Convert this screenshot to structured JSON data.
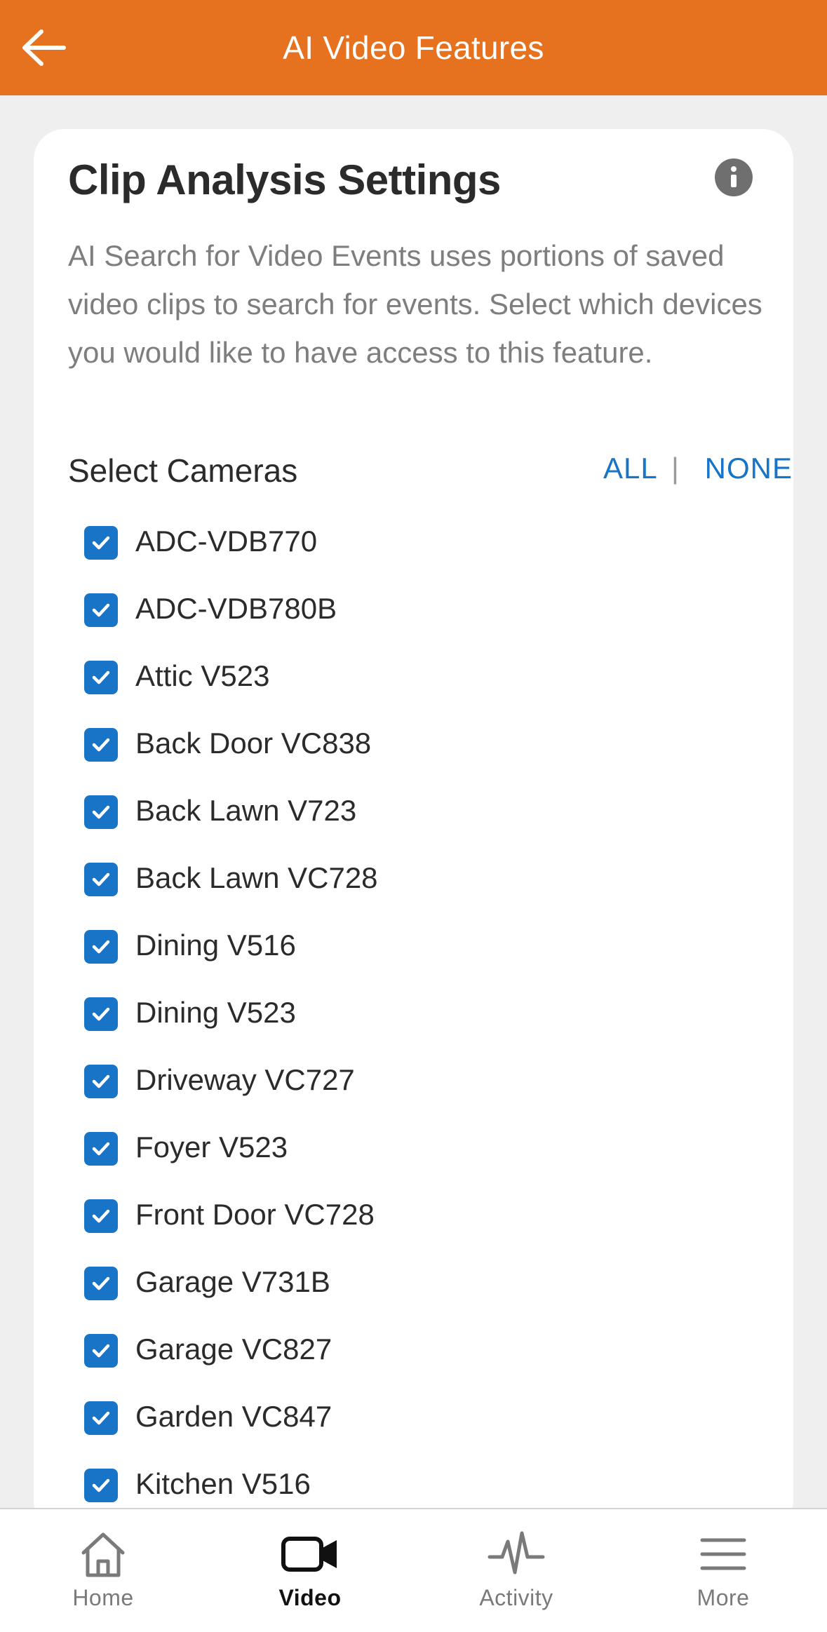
{
  "header": {
    "title": "AI Video Features",
    "back_icon": "arrow-left-icon"
  },
  "card": {
    "title": "Clip Analysis Settings",
    "info_icon": "info-icon",
    "description": "AI Search for Video Events uses portions of saved video clips to search for events. Select which devices you would like to have access to this feature.",
    "select_label": "Select Cameras",
    "all_label": "ALL",
    "separator": "|",
    "none_label": "NONE"
  },
  "cameras": [
    {
      "label": "ADC-VDB770",
      "checked": true
    },
    {
      "label": "ADC-VDB780B",
      "checked": true
    },
    {
      "label": "Attic V523",
      "checked": true
    },
    {
      "label": "Back Door VC838",
      "checked": true
    },
    {
      "label": "Back Lawn V723",
      "checked": true
    },
    {
      "label": "Back Lawn VC728",
      "checked": true
    },
    {
      "label": "Dining V516",
      "checked": true
    },
    {
      "label": "Dining V523",
      "checked": true
    },
    {
      "label": "Driveway VC727",
      "checked": true
    },
    {
      "label": "Foyer V523",
      "checked": true
    },
    {
      "label": "Front Door VC728",
      "checked": true
    },
    {
      "label": "Garage V731B",
      "checked": true
    },
    {
      "label": "Garage VC827",
      "checked": true
    },
    {
      "label": "Garden VC847",
      "checked": true
    },
    {
      "label": "Kitchen V516",
      "checked": true
    }
  ],
  "tabs": [
    {
      "label": "Home",
      "icon": "home-icon",
      "active": false
    },
    {
      "label": "Video",
      "icon": "video-camera-icon",
      "active": true
    },
    {
      "label": "Activity",
      "icon": "activity-icon",
      "active": false
    },
    {
      "label": "More",
      "icon": "menu-icon",
      "active": false
    }
  ],
  "colors": {
    "header": "#e6721f",
    "accent_blue": "#1774c6",
    "background": "#efefef"
  }
}
